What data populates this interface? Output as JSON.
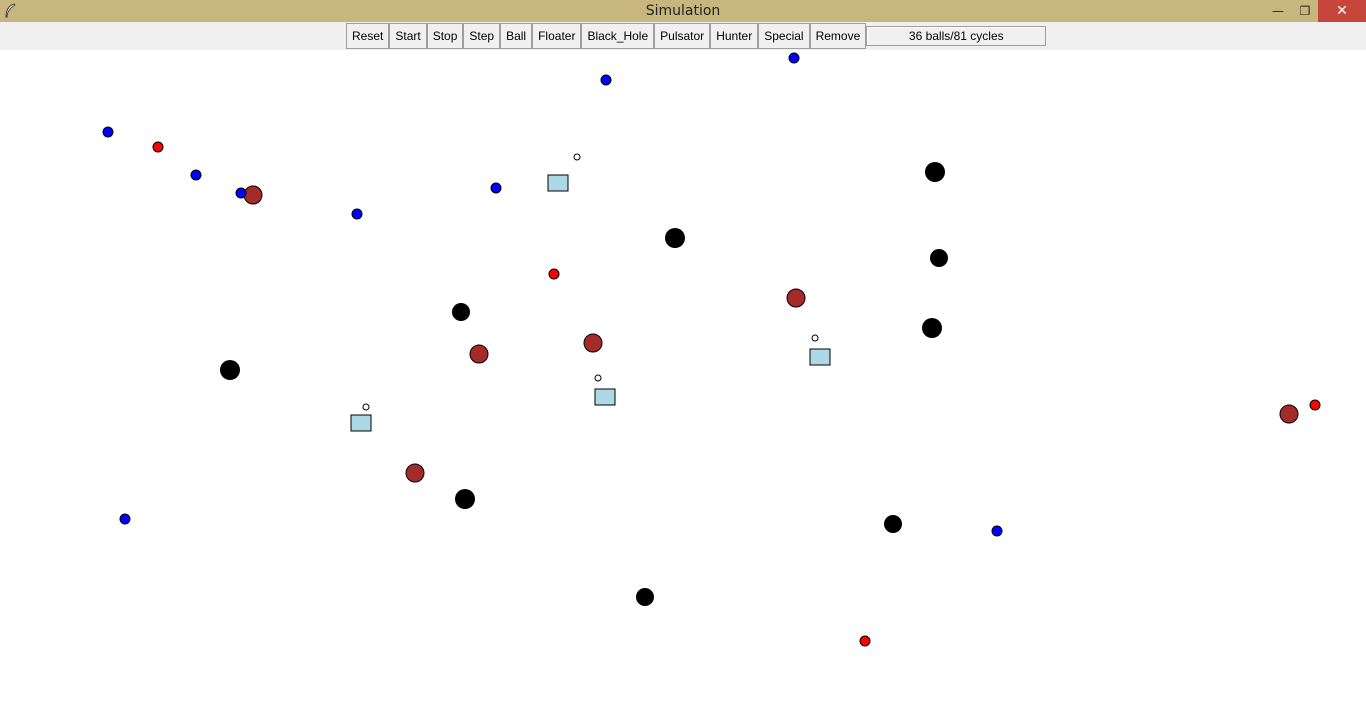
{
  "window": {
    "title": "Simulation",
    "app_icon": "feather-icon",
    "controls": {
      "minimize": "minimize-icon",
      "maximize": "restore-icon",
      "close": "close-icon"
    }
  },
  "toolbar": {
    "buttons": [
      "Reset",
      "Start",
      "Stop",
      "Step",
      "Ball",
      "Floater",
      "Black_Hole",
      "Pulsator",
      "Hunter",
      "Special",
      "Remove"
    ],
    "status": "36 balls/81 cycles"
  },
  "colors": {
    "titlebar": "#c7b77f",
    "ball": "#0000ff",
    "hunter": "#ff0000",
    "pulsator": "#a52a2a",
    "black_hole": "#000000",
    "floater": "#add8e6"
  }
}
